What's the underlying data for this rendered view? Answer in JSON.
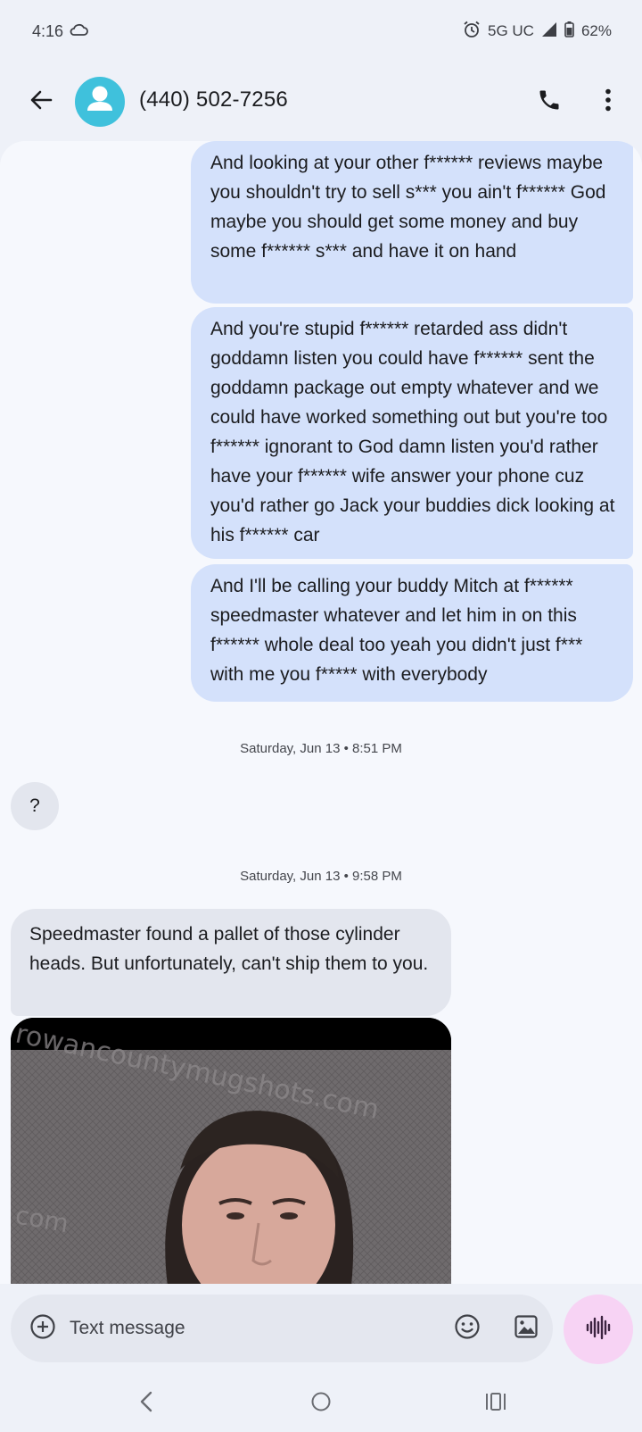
{
  "status_bar": {
    "time": "4:16",
    "network": "5G UC",
    "battery": "62%",
    "icons": [
      "cloud-icon",
      "alarm-icon",
      "signal-icon",
      "battery-icon"
    ]
  },
  "header": {
    "contact": "(440) 502-7256",
    "icons": [
      "back-arrow-icon",
      "avatar-person-icon",
      "phone-icon",
      "more-vert-icon"
    ]
  },
  "messages": {
    "outgoing": [
      "And looking at your other f****** reviews maybe you shouldn't try to sell s*** you ain't f****** God maybe you should get some money and buy some f****** s*** and have it on hand",
      "And you're stupid f****** retarded ass didn't goddamn listen you could have f****** sent the goddamn package out empty whatever and we could have worked something out but you're too f****** ignorant to God damn listen you'd rather have your f****** wife answer your phone cuz you'd rather go Jack your buddies dick looking at his f****** car",
      "And I'll be calling your buddy Mitch at f****** speedmaster whatever and let him in on this f****** whole deal too yeah you didn't just f*** with me you f***** with everybody"
    ],
    "timestamp_1": "Saturday, Jun 13 • 8:51 PM",
    "incoming_1": "?",
    "timestamp_2": "Saturday, Jun 13 • 9:58 PM",
    "incoming_2": "Speedmaster found a pallet of those cylinder heads.   But unfortunately, can't ship them to you.",
    "photo_watermark": "rowancountymugshots.com"
  },
  "composer": {
    "placeholder": "Text message",
    "icons": [
      "add-circle-icon",
      "emoji-icon",
      "gallery-icon",
      "voice-waveform-icon"
    ]
  },
  "nav": {
    "icons": [
      "recents-icon",
      "home-icon",
      "back-icon"
    ]
  },
  "colors": {
    "background": "#eef1f8",
    "outgoing_bubble": "#d4e1fb",
    "incoming_bubble": "#e3e6ee",
    "avatar": "#3fc1dc",
    "voice_button": "#f7d3f4"
  }
}
